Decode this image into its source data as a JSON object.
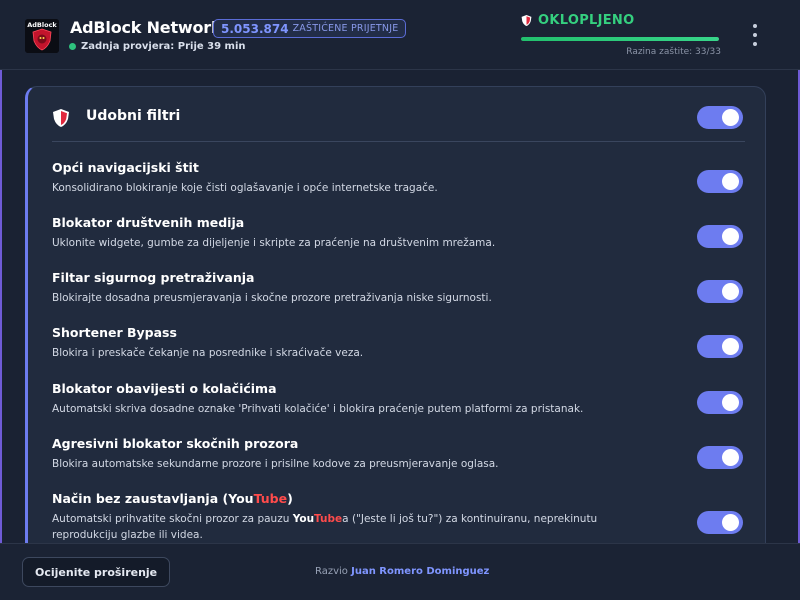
{
  "header": {
    "title": "AdBlock Network",
    "logo_text": "AdBlock",
    "blocked_count": "5.053.874",
    "blocked_label": "ZAŠTIĆENE PRIJETNJE",
    "last_check": "Zadnja provjera: Prije 39 min",
    "status": "OKLOPLJENO",
    "protection_level": "Razina zaštite: 33/33",
    "protection_fraction": 1.0,
    "accent": "#6d7cf0",
    "status_color": "#35d07f"
  },
  "card": {
    "title": "Udobni filtri",
    "enabled": true
  },
  "filters": [
    {
      "title": "Opći navigacijski štit",
      "desc": "Konsolidirano blokiranje koje čisti oglašavanje i opće internetske tragače.",
      "enabled": true
    },
    {
      "title": "Blokator društvenih medija",
      "desc": "Uklonite widgete, gumbe za dijeljenje i skripte za praćenje na društvenim mrežama.",
      "enabled": true
    },
    {
      "title": "Filtar sigurnog pretraživanja",
      "desc": "Blokirajte dosadna preusmjeravanja i skočne prozore pretraživanja niske sigurnosti.",
      "enabled": true
    },
    {
      "title": "Shortener Bypass",
      "desc": "Blokira i preskače čekanje na posrednike i skraćivače veza.",
      "enabled": true
    },
    {
      "title": "Blokator obavijesti o kolačićima",
      "desc": "Automatski skriva dosadne oznake 'Prihvati kolačiće' i blokira praćenje putem platformi za pristanak.",
      "enabled": true
    },
    {
      "title": "Agresivni blokator skočnih prozora",
      "desc": "Blokira automatske sekundarne prozore i prisilne kodove za preusmjeravanje oglasa.",
      "enabled": true
    },
    {
      "title_a": "Način bez zaustavljanja (You",
      "title_b": "Tube",
      "title_c": ")",
      "desc_a": "Automatski prihvatite skočni prozor za pauzu ",
      "desc_you": "You",
      "desc_tube": "Tube",
      "desc_b": "a (\"Jeste li još tu?\") za kontinuiranu, neprekinutu reprodukciju glazbe ili videa.",
      "enabled": true
    }
  ],
  "footer": {
    "rate_button": "Ocijenite proširenje",
    "credit_prefix": "Razvio",
    "credit_name": "Juan Romero Dominguez"
  }
}
